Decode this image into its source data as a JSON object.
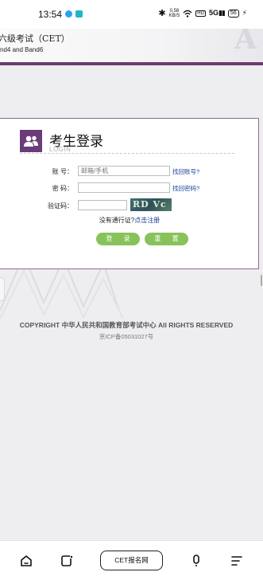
{
  "status_bar": {
    "time": "13:54",
    "net_speed_value": "0.58",
    "net_speed_unit": "KB/S",
    "signal": "5G",
    "battery": "56"
  },
  "header": {
    "title": "六级考试（CET）",
    "subtitle": "nd4 and Band6",
    "watermark": "A"
  },
  "login": {
    "title": "考生登录",
    "subtitle": "LOGIN",
    "account_label": "账 号：",
    "account_placeholder": "邮箱/手机",
    "account_value": "",
    "find_account": "找回账号?",
    "password_label": "密 码：",
    "password_value": "",
    "find_password": "找回密码?",
    "captcha_label": "验证码：",
    "captcha_value": "",
    "captcha_text": "RD Vc",
    "no_pass_text": "没有通行证?",
    "register_link": "点击注册",
    "login_button": "登 录",
    "reset_button": "重 置"
  },
  "footer": {
    "copyright": "COPYRIGHT 中华人民共和国教育部考试中心 All RIGHTS RESERVED",
    "icp": "京ICP备05031027号"
  },
  "bottom_nav": {
    "url_label": "CET报名网",
    "home_icon": "home-icon",
    "tabs_icon": "tabs-icon",
    "voice_icon": "microphone-icon",
    "menu_icon": "menu-icon"
  },
  "colors": {
    "accent_purple": "#6b3c6e",
    "button_green": "#87c35a",
    "link_blue": "#1a3f9a"
  }
}
